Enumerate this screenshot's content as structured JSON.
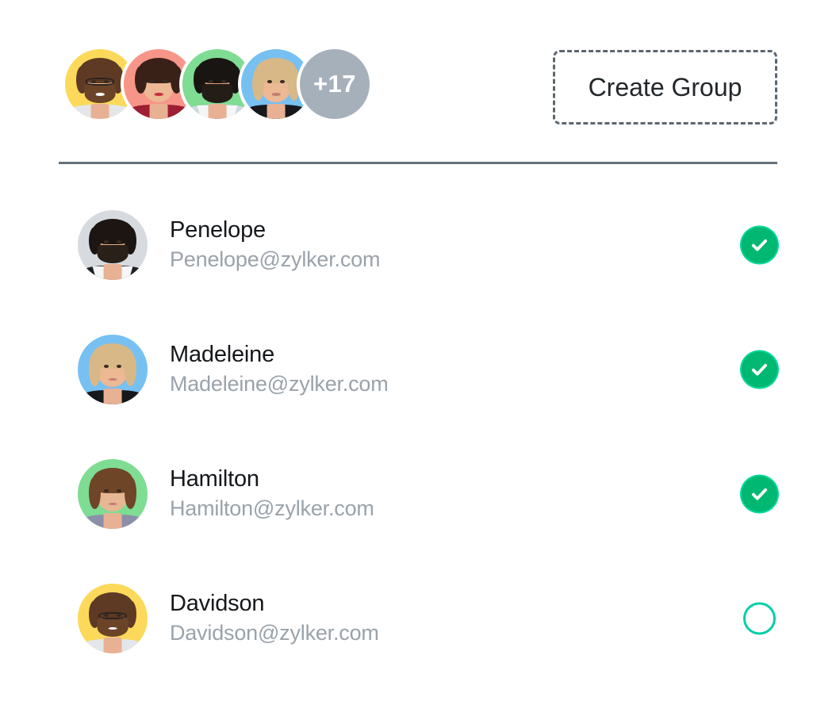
{
  "colors": {
    "background": "#ffffff",
    "divider": "#66707a",
    "button_border": "#5c6670",
    "button_text": "#22272b",
    "name_text": "#15181b",
    "email_text": "#9aa2aa",
    "check_on_fill": "#00b871",
    "check_on_ring": "#06d89a",
    "check_off_ring": "#00cfa8",
    "more_badge_bg": "#a6b0bb",
    "more_badge_text": "#ffffff"
  },
  "header": {
    "avatar_stack": [
      {
        "name": "avatar-stack-1",
        "bg": "#fcd95b",
        "person": "curly-haired-man-with-glasses"
      },
      {
        "name": "avatar-stack-2",
        "bg": "#f79589",
        "person": "smiling-woman-in-red-top"
      },
      {
        "name": "avatar-stack-3",
        "bg": "#7edc93",
        "person": "bearded-man-in-suit-and-tie"
      },
      {
        "name": "avatar-stack-4",
        "bg": "#77c0f2",
        "person": "blonde-woman-in-black-top"
      }
    ],
    "overflow_badge": {
      "label": "+17",
      "bg": "#a6b0bb"
    },
    "create_group_button": {
      "label": "Create Group",
      "style": "dashed-outline"
    }
  },
  "contacts": [
    {
      "name": "Penelope",
      "email": "Penelope@zylker.com",
      "selected": true,
      "avatar_bg": "#d7dbe0",
      "avatar_person": "bearded-man-in-dark-jacket",
      "check_icon": "check-circle-filled-icon"
    },
    {
      "name": "Madeleine",
      "email": "Madeleine@zylker.com",
      "selected": true,
      "avatar_bg": "#77c0f2",
      "avatar_person": "blonde-woman-in-black-top",
      "check_icon": "check-circle-filled-icon"
    },
    {
      "name": "Hamilton",
      "email": "Hamilton@zylker.com",
      "selected": true,
      "avatar_bg": "#7edc93",
      "avatar_person": "curly-haired-woman-in-grey-top",
      "check_icon": "check-circle-filled-icon"
    },
    {
      "name": "Davidson",
      "email": "Davidson@zylker.com",
      "selected": false,
      "avatar_bg": "#fcd95b",
      "avatar_person": "curly-haired-man-with-glasses",
      "check_icon": "circle-outline-icon"
    }
  ]
}
